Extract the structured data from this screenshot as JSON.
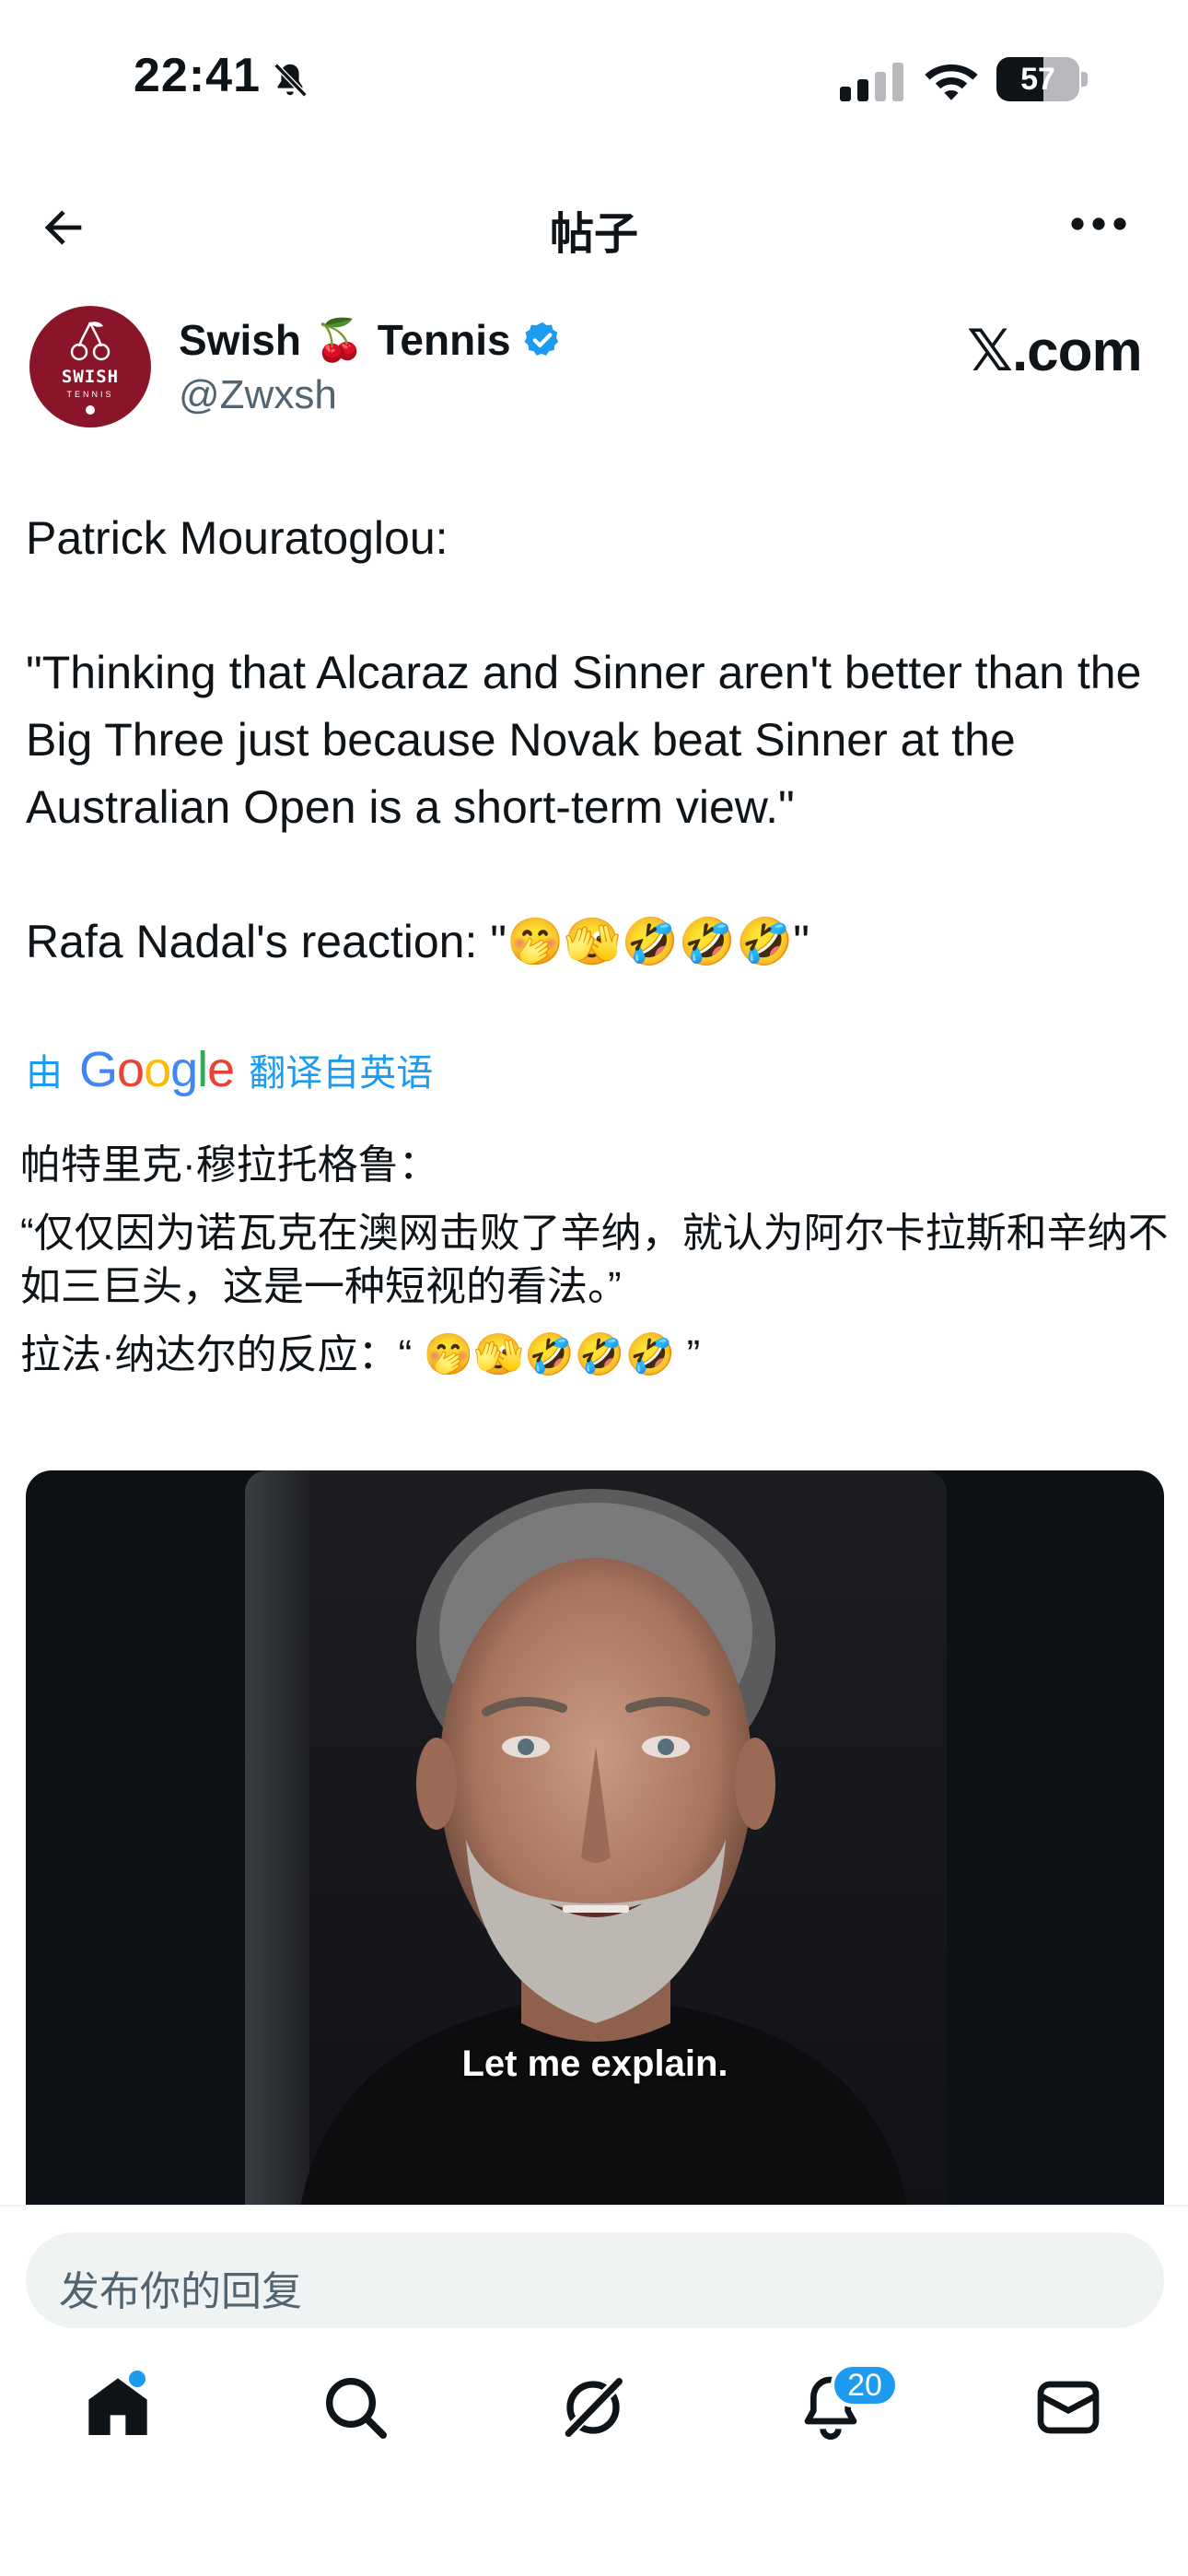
{
  "status_bar": {
    "time": "22:41",
    "battery_percent": "57",
    "battery_level": 0.57,
    "icons": [
      "bell-muted-icon",
      "signal-icon",
      "wifi-icon",
      "battery-icon"
    ]
  },
  "header": {
    "title": "帖子",
    "back_icon": "arrow-left-icon",
    "more_icon": "more-horizontal-icon"
  },
  "author": {
    "name_part1": "Swish",
    "name_emoji": "🍒",
    "name_part2": "Tennis",
    "handle": "@Zwxsh",
    "verified": true,
    "avatar_text": "SWISH",
    "avatar_subtext": "TENNIS",
    "watermark": "𝕏.com"
  },
  "tweet": {
    "line1": "Patrick Mouratoglou:",
    "quote": "\"Thinking that Alcaraz and Sinner aren't better than the Big Three just because Novak beat Sinner at the Australian Open is a short-term view.\"",
    "reaction": "Rafa Nadal's reaction: \"🤭🫣🤣🤣🤣\""
  },
  "translation": {
    "prefix": "由",
    "provider": "Google",
    "suffix": "翻译自英语",
    "line1": "帕特里克·穆拉托格鲁：",
    "line2": "“仅仅因为诺瓦克在澳网击败了辛纳，就认为阿尔卡拉斯和辛纳不如三巨头，这是一种短视的看法。”",
    "line3": "拉法·纳达尔的反应：“ 🤭🫣🤣🤣🤣 ”"
  },
  "video": {
    "caption": "Let me explain."
  },
  "reply": {
    "placeholder": "发布你的回复"
  },
  "tabbar": {
    "items": [
      "home-icon",
      "search-icon",
      "grok-icon",
      "notifications-icon",
      "messages-icon"
    ],
    "notification_count": "20"
  },
  "colors": {
    "accent": "#1d9bf0",
    "text": "#0f1419",
    "secondary_text": "#536471",
    "avatar_bg": "#8a1428"
  }
}
